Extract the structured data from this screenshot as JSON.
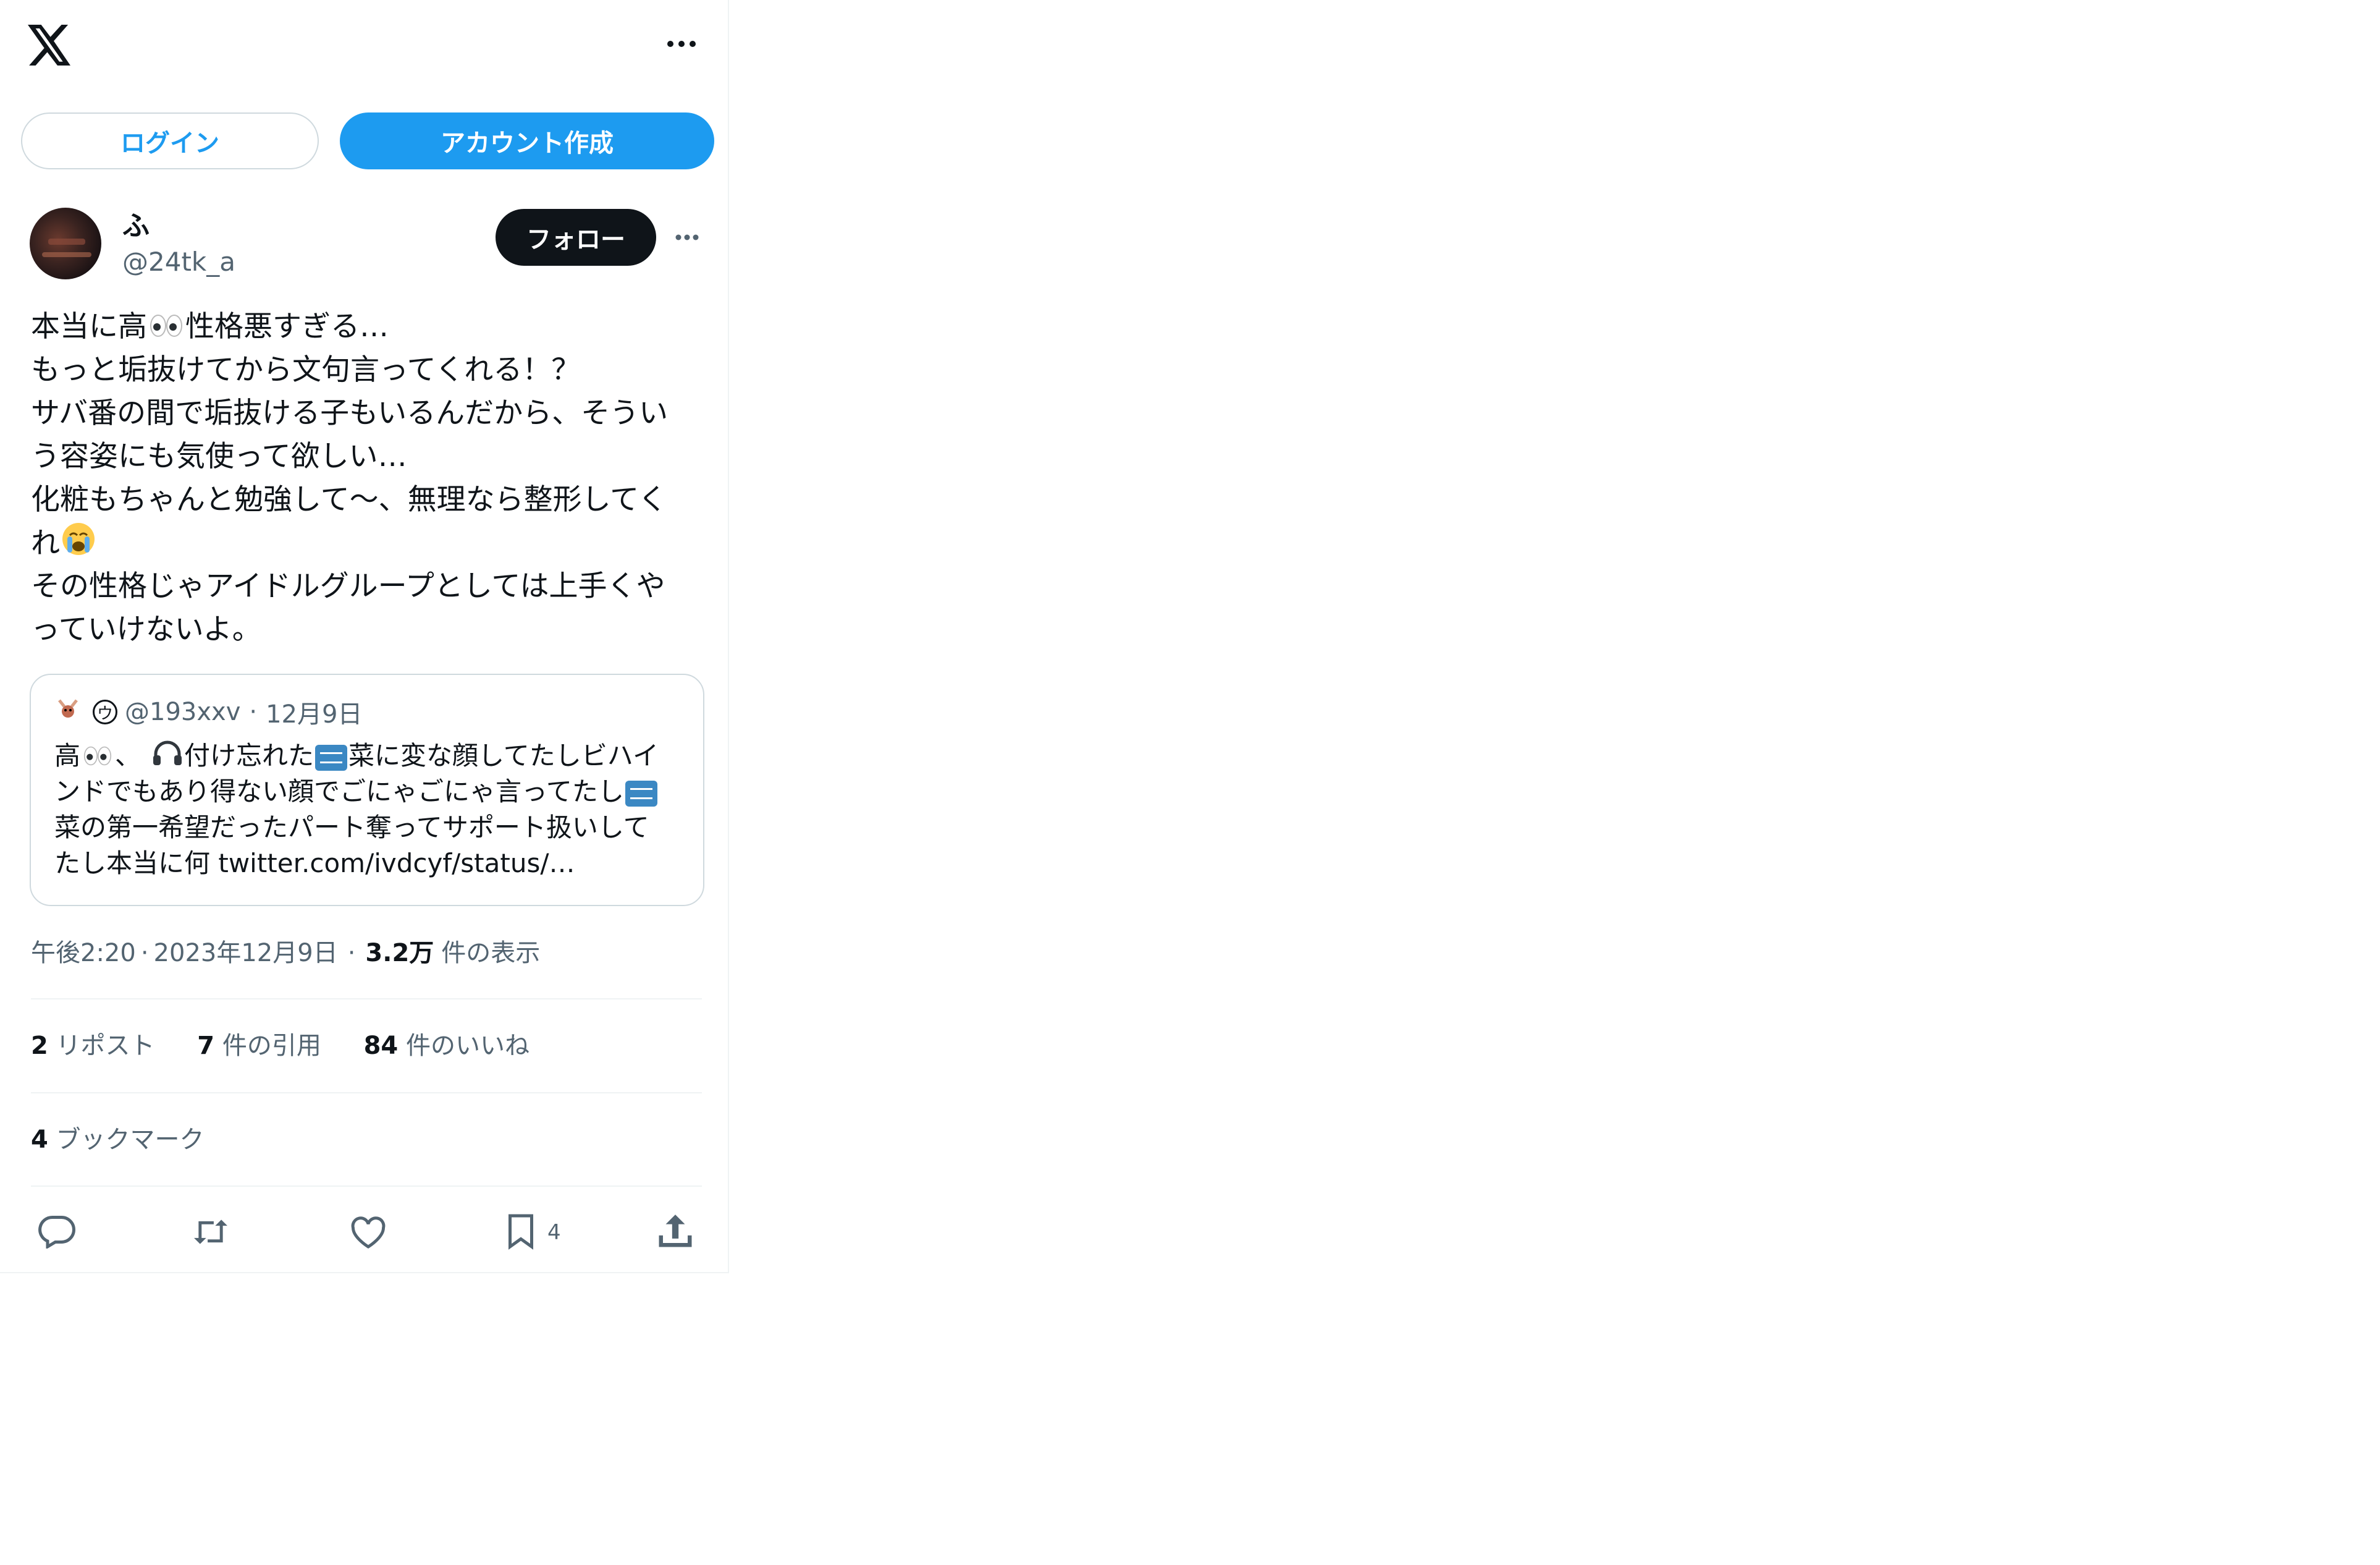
{
  "header": {
    "logo": "x-logo",
    "more_icon": "more-horizontal-icon"
  },
  "auth": {
    "login_label": "ログイン",
    "signup_label": "アカウント作成",
    "accent": "#1d9bf0"
  },
  "author": {
    "name": "ふ",
    "handle": "@24tk_a",
    "follow_label": "フォロー"
  },
  "tweet": {
    "lines": [
      [
        "本当に高",
        "性格悪すぎる…"
      ],
      [
        "もっと垢抜けてから文句言ってくれる！？"
      ],
      [
        "サバ番の間で垢抜ける子もいるんだから、そうい"
      ],
      [
        "う容姿にも気使って欲しい…"
      ],
      [
        "化粧もちゃんと勉強して〜、無理なら整形してく"
      ],
      [
        "れ"
      ],
      [
        "その性格じゃアイドルグループとしては上手くや"
      ],
      [
        "っていけないよ。"
      ]
    ]
  },
  "quote": {
    "verified_mark": "ウ",
    "handle": "@193xxv",
    "dot": "·",
    "date": "12月9日",
    "line1_a": "高",
    "line1_b": "、",
    "line1_c": "付け忘れた",
    "line1_d": "菜に変な顔してたしビハイ",
    "line2_a": "ンドでもあり得ない顔でごにゃごにゃ言ってたし",
    "line3": "菜の第一希望だったパート奪ってサポート扱いして",
    "line4": "たし本当に何 twitter.com/ivdcyf/status/…"
  },
  "meta": {
    "time": "午後2:20",
    "sep": "·",
    "date": "2023年12月9日",
    "views_num": "3.2万",
    "views_label": "件の表示"
  },
  "stats": {
    "reposts_num": "2",
    "reposts_label": "リポスト",
    "quotes_num": "7",
    "quotes_label": "件の引用",
    "likes_num": "84",
    "likes_label": "件のいいね",
    "bookmarks_num": "4",
    "bookmarks_label": "ブックマーク"
  },
  "actions": {
    "bookmark_count": "4"
  }
}
